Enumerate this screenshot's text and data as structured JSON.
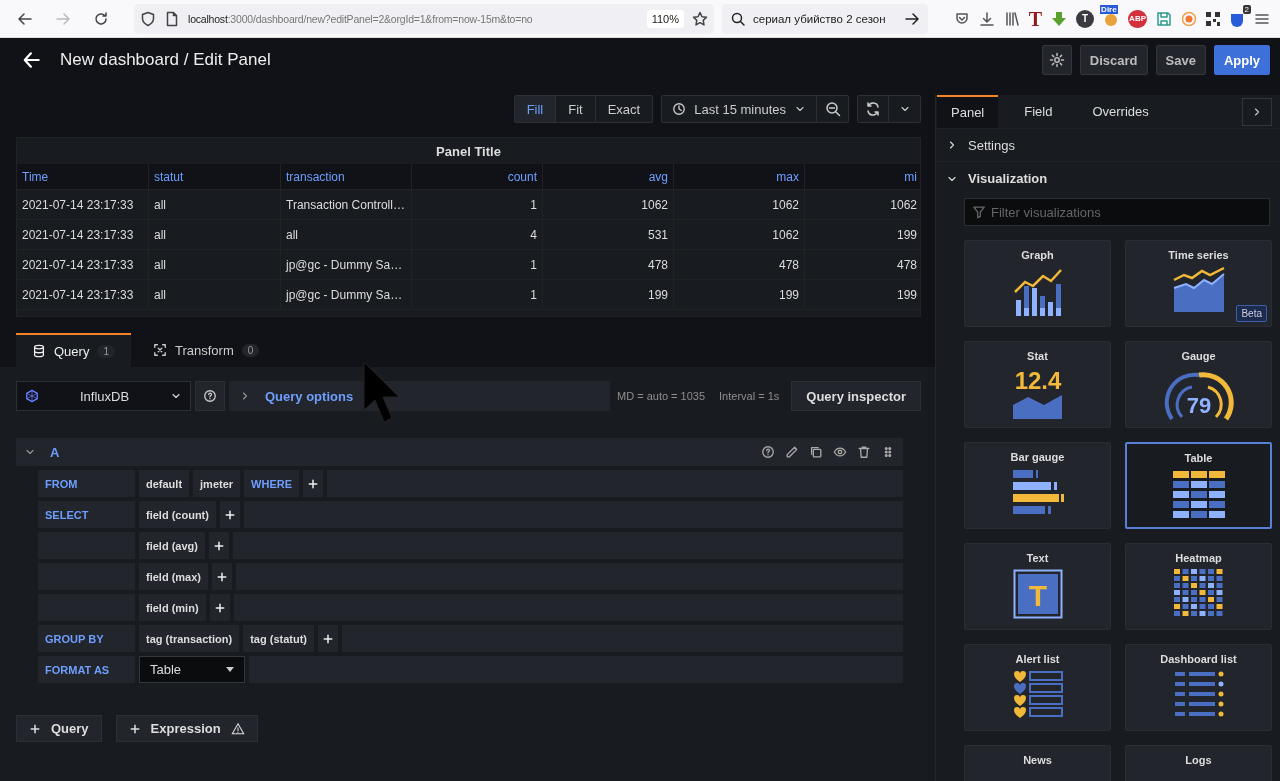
{
  "browser": {
    "url_host": "localhost",
    "url_path": ":3000/dashboard/new?editPanel=2&orgId=1&from=now-15m&to=no",
    "zoom": "110%",
    "search": "сериал убийство 2 сезон",
    "extensions": [
      {
        "kind": "pocket"
      },
      {
        "kind": "download"
      },
      {
        "kind": "library"
      },
      {
        "kind": "letter",
        "text": "T",
        "color": "#8b1c1c"
      },
      {
        "kind": "arrow"
      },
      {
        "kind": "circle-letter",
        "text": "T",
        "color": "#3a3a40"
      },
      {
        "kind": "badge-top",
        "text": "Dire"
      },
      {
        "kind": "circle-letter",
        "text": "ABP",
        "color": "#d2303c"
      },
      {
        "kind": "floppy"
      },
      {
        "kind": "record"
      },
      {
        "kind": "qr"
      },
      {
        "kind": "badge-count",
        "text": "2"
      },
      {
        "kind": "menu"
      }
    ]
  },
  "header": {
    "title": "New dashboard / Edit Panel",
    "buttons": [
      {
        "label": "Discard",
        "kind": "secondary"
      },
      {
        "label": "Save",
        "kind": "secondary"
      },
      {
        "label": "Apply",
        "kind": "primary"
      }
    ]
  },
  "toolbar": {
    "view_modes": [
      {
        "label": "Fill",
        "selected": true
      },
      {
        "label": "Fit",
        "selected": false
      },
      {
        "label": "Exact",
        "selected": false
      }
    ],
    "time_range": "Last 15 minutes"
  },
  "panel": {
    "title": "Panel Title",
    "columns": [
      "Time",
      "statut",
      "transaction",
      "count",
      "avg",
      "max",
      "mi"
    ],
    "rows": [
      [
        "2021-07-14 23:17:33",
        "all",
        "Transaction Controll…",
        "1",
        "1062",
        "1062",
        "1062"
      ],
      [
        "2021-07-14 23:17:33",
        "all",
        "all",
        "4",
        "531",
        "1062",
        "199"
      ],
      [
        "2021-07-14 23:17:33",
        "all",
        "jp@gc - Dummy Sa…",
        "1",
        "478",
        "478",
        "478"
      ],
      [
        "2021-07-14 23:17:33",
        "all",
        "jp@gc - Dummy Sa…",
        "1",
        "199",
        "199",
        "199"
      ]
    ]
  },
  "query_tabs": [
    {
      "label": "Query",
      "count": "1",
      "selected": true
    },
    {
      "label": "Transform",
      "count": "0",
      "selected": false
    }
  ],
  "query_bar": {
    "datasource": "InfluxDB",
    "options": "Query options",
    "max_data_points": "MD = auto = 1035",
    "interval": "Interval = 1s",
    "inspector": "Query inspector"
  },
  "query": {
    "name": "A",
    "expanded": true,
    "rows": [
      {
        "keyword": "FROM",
        "parts": [
          {
            "kind": "value",
            "text": "default"
          },
          {
            "kind": "value",
            "text": "jmeter"
          },
          {
            "kind": "keyword",
            "text": "WHERE"
          },
          {
            "kind": "add"
          }
        ]
      },
      {
        "keyword": "SELECT",
        "parts": [
          {
            "kind": "value",
            "text": "field (count)"
          },
          {
            "kind": "add"
          }
        ]
      },
      {
        "parts": [
          {
            "kind": "value",
            "text": "field (avg)"
          },
          {
            "kind": "add"
          }
        ]
      },
      {
        "parts": [
          {
            "kind": "value",
            "text": "field (max)"
          },
          {
            "kind": "add"
          }
        ]
      },
      {
        "parts": [
          {
            "kind": "value",
            "text": "field (min)"
          },
          {
            "kind": "add"
          }
        ]
      },
      {
        "keyword": "GROUP BY",
        "parts": [
          {
            "kind": "value",
            "text": "tag (transaction)"
          },
          {
            "kind": "value",
            "text": "tag (statut)"
          },
          {
            "kind": "add"
          }
        ]
      },
      {
        "keyword": "FORMAT AS",
        "parts": [
          {
            "kind": "select",
            "text": "Table"
          }
        ]
      }
    ]
  },
  "add_buttons": [
    {
      "label": "Query",
      "warning": false
    },
    {
      "label": "Expression",
      "warning": true
    }
  ],
  "options": {
    "tabs": [
      {
        "label": "Panel",
        "selected": true
      },
      {
        "label": "Field",
        "selected": false
      },
      {
        "label": "Overrides",
        "selected": false
      }
    ],
    "sections": [
      {
        "label": "Settings",
        "expanded": false
      },
      {
        "label": "Visualization",
        "expanded": true
      }
    ],
    "filter_placeholder": "Filter visualizations",
    "visualizations": [
      {
        "label": "Graph",
        "selected": false
      },
      {
        "label": "Time series",
        "selected": false,
        "badge": "Beta"
      },
      {
        "label": "Stat",
        "selected": false,
        "figure_text": "12.4"
      },
      {
        "label": "Gauge",
        "selected": false,
        "figure_text": "79"
      },
      {
        "label": "Bar gauge",
        "selected": false
      },
      {
        "label": "Table",
        "selected": true
      },
      {
        "label": "Text",
        "selected": false,
        "figure_text": "T"
      },
      {
        "label": "Heatmap",
        "selected": false
      },
      {
        "label": "Alert list",
        "selected": false
      },
      {
        "label": "Dashboard list",
        "selected": false
      },
      {
        "label": "News",
        "selected": false
      },
      {
        "label": "Logs",
        "selected": false
      }
    ]
  }
}
